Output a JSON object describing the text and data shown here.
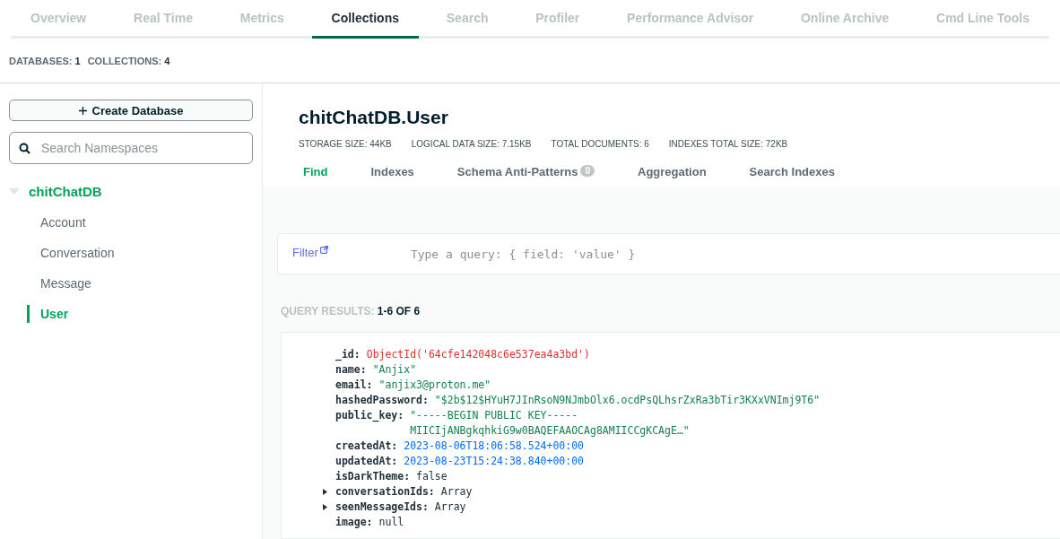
{
  "nav_tabs": [
    {
      "label": "Overview",
      "selected": false
    },
    {
      "label": "Real Time",
      "selected": false
    },
    {
      "label": "Metrics",
      "selected": false
    },
    {
      "label": "Collections",
      "selected": true
    },
    {
      "label": "Search",
      "selected": false
    },
    {
      "label": "Profiler",
      "selected": false
    },
    {
      "label": "Performance Advisor",
      "selected": false
    },
    {
      "label": "Online Archive",
      "selected": false
    },
    {
      "label": "Cmd Line Tools",
      "selected": false
    }
  ],
  "counts": [
    {
      "label": "DATABASES:",
      "value": "1"
    },
    {
      "label": "COLLECTIONS:",
      "value": "4"
    }
  ],
  "sidebar": {
    "create_button": "Create Database",
    "search": {
      "placeholder": "Search Namespaces"
    },
    "tree": [
      {
        "label": "chitChatDB",
        "expanded": true,
        "children": [
          {
            "label": "Account",
            "selected": false
          },
          {
            "label": "Conversation",
            "selected": false
          },
          {
            "label": "Message",
            "selected": false
          },
          {
            "label": "User",
            "selected": true
          }
        ]
      }
    ]
  },
  "collection": {
    "title": "chitChatDB.User",
    "stats": [
      {
        "label": "STORAGE SIZE:",
        "value": "44KB"
      },
      {
        "label": "LOGICAL DATA SIZE:",
        "value": "7.15KB"
      },
      {
        "label": "TOTAL DOCUMENTS:",
        "value": "6"
      },
      {
        "label": "INDEXES TOTAL SIZE:",
        "value": "72KB"
      }
    ],
    "tabs": [
      {
        "label": "Find",
        "selected": true
      },
      {
        "label": "Indexes",
        "selected": false
      },
      {
        "label": "Schema Anti-Patterns",
        "selected": false,
        "badge": "0"
      },
      {
        "label": "Aggregation",
        "selected": false
      },
      {
        "label": "Search Indexes",
        "selected": false
      }
    ]
  },
  "filter": {
    "label": "Filter",
    "placeholder": "Type a query: { field: 'value' }"
  },
  "results": {
    "label": "QUERY RESULTS:",
    "value": "1-6 OF 6"
  },
  "document": [
    {
      "key": "_id:",
      "kind": "objectid",
      "lines": [
        "ObjectId('64cfe142048c6e537ea4a3bd')"
      ]
    },
    {
      "key": "name:",
      "kind": "string",
      "lines": [
        "\"Anjix\""
      ]
    },
    {
      "key": "email:",
      "kind": "string",
      "lines": [
        "\"anjix3@proton.me\""
      ]
    },
    {
      "key": "hashedPassword:",
      "kind": "string",
      "lines": [
        "\"$2b$12$HYuH7JInRsoN9NJmbOlx6.ocdPsQLhsrZxRa3bTir3KXxVNImj9T6\""
      ]
    },
    {
      "key": "public_key:",
      "kind": "string",
      "lines": [
        "\"-----BEGIN PUBLIC KEY-----",
        "MIICIjANBgkqhkiG9w0BAQEFAAOCAg8AMIICCgKCAgE…\""
      ]
    },
    {
      "key": "createdAt:",
      "kind": "date",
      "lines": [
        "2023-08-06T18:06:58.524+00:00"
      ]
    },
    {
      "key": "updatedAt:",
      "kind": "date",
      "lines": [
        "2023-08-23T15:24:38.840+00:00"
      ]
    },
    {
      "key": "isDarkTheme:",
      "kind": "plain",
      "lines": [
        "false"
      ]
    },
    {
      "key": "conversationIds:",
      "kind": "array",
      "expanded": false,
      "lines": [
        "Array"
      ]
    },
    {
      "key": "seenMessageIds:",
      "kind": "array",
      "expanded": false,
      "lines": [
        "Array"
      ]
    },
    {
      "key": "image:",
      "kind": "plain",
      "lines": [
        "null"
      ]
    }
  ]
}
